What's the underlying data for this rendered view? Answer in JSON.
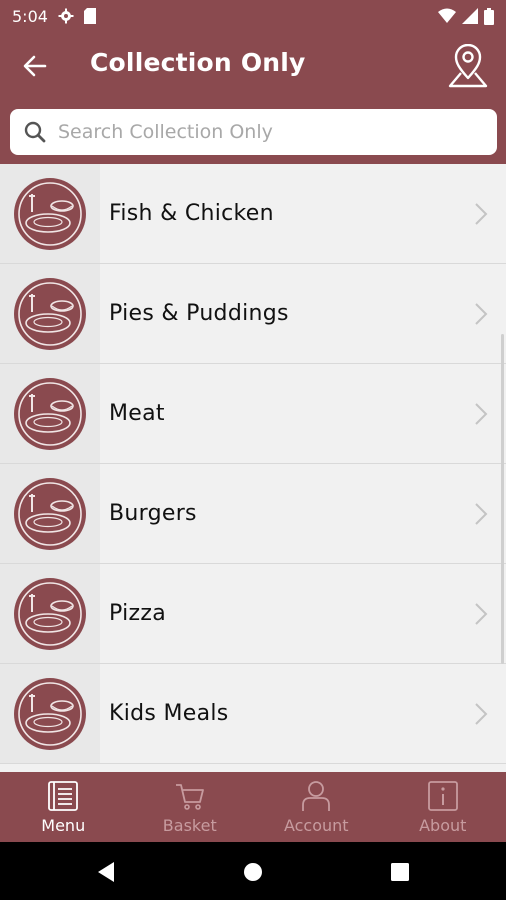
{
  "status_bar": {
    "time": "5:04",
    "left_icons": [
      "gear-icon",
      "sd-card-icon"
    ],
    "right_icons": [
      "wifi-icon",
      "signal-icon",
      "battery-icon"
    ]
  },
  "header": {
    "title": "Collection Only",
    "back_icon": "arrow-left-icon",
    "location_icon": "map-pin-icon"
  },
  "search": {
    "placeholder": "Search Collection Only",
    "value": ""
  },
  "categories": [
    {
      "label": "Fish & Chicken"
    },
    {
      "label": "Pies & Puddings"
    },
    {
      "label": "Meat"
    },
    {
      "label": "Burgers"
    },
    {
      "label": "Pizza"
    },
    {
      "label": "Kids Meals"
    }
  ],
  "bottom_nav": {
    "items": [
      {
        "label": "Menu",
        "icon": "menu-book-icon",
        "active": true
      },
      {
        "label": "Basket",
        "icon": "cart-icon",
        "active": false
      },
      {
        "label": "Account",
        "icon": "person-icon",
        "active": false
      },
      {
        "label": "About",
        "icon": "info-icon",
        "active": false
      }
    ]
  },
  "colors": {
    "brand": "#8a4a4f",
    "background": "#f1f1f1",
    "nav_inactive": "#c79b9f"
  }
}
